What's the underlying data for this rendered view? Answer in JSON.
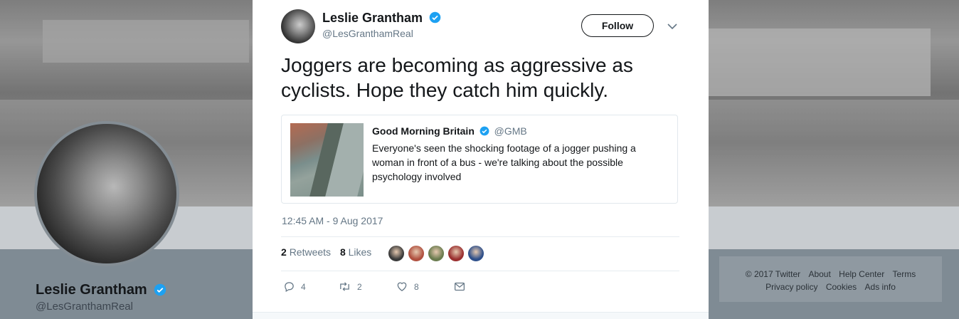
{
  "profile": {
    "name": "Leslie Grantham",
    "handle": "@LesGranthamReal"
  },
  "footer": {
    "links": [
      "© 2017 Twitter",
      "About",
      "Help Center",
      "Terms",
      "Privacy policy",
      "Cookies",
      "Ads info"
    ]
  },
  "tweet": {
    "author_name": "Leslie Grantham",
    "author_handle": "@LesGranthamReal",
    "follow_label": "Follow",
    "text": "Joggers are becoming as aggressive as cyclists. Hope they catch him quickly.",
    "quote": {
      "name": "Good Morning Britain",
      "handle": "@GMB",
      "text": "Everyone's seen the shocking footage of a jogger pushing a woman in front of a bus - we're talking about the possible psychology involved"
    },
    "timestamp": "12:45 AM - 9 Aug 2017",
    "retweets_count": "2",
    "retweets_label": "Retweets",
    "likes_count": "8",
    "likes_label": "Likes",
    "likers": [
      "#3a3a3a",
      "#b0503f",
      "#6a7b4e",
      "#9a2f2f",
      "#2e4f8a"
    ],
    "actions": {
      "reply_count": "4",
      "retweet_count": "2",
      "like_count": "8"
    }
  },
  "colors": {
    "verified": "#1da1f2",
    "action_gray": "#657786"
  }
}
